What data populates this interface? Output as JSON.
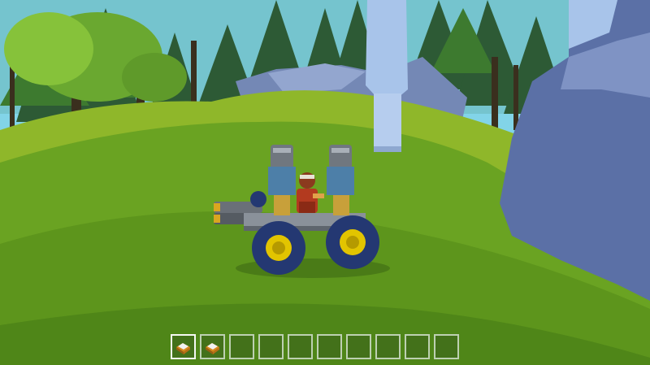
{
  "scene": {
    "sky_color": "#7fd3e6",
    "grass_color": "#6da51f",
    "rock_color": "#5d71a8"
  },
  "vehicle": {
    "type": "buggy",
    "driver": "player-character",
    "body_color": "#8a919a",
    "wheel_hub_color": "#e2c400"
  },
  "hotbar": {
    "slot_count": 10,
    "selected_index": 0,
    "slots": [
      {
        "icon": "block-item-icon",
        "filled": true
      },
      {
        "icon": "block-item-icon",
        "filled": true
      },
      {
        "icon": "",
        "filled": false
      },
      {
        "icon": "",
        "filled": false
      },
      {
        "icon": "",
        "filled": false
      },
      {
        "icon": "",
        "filled": false
      },
      {
        "icon": "",
        "filled": false
      },
      {
        "icon": "",
        "filled": false
      },
      {
        "icon": "",
        "filled": false
      },
      {
        "icon": "",
        "filled": false
      }
    ]
  }
}
